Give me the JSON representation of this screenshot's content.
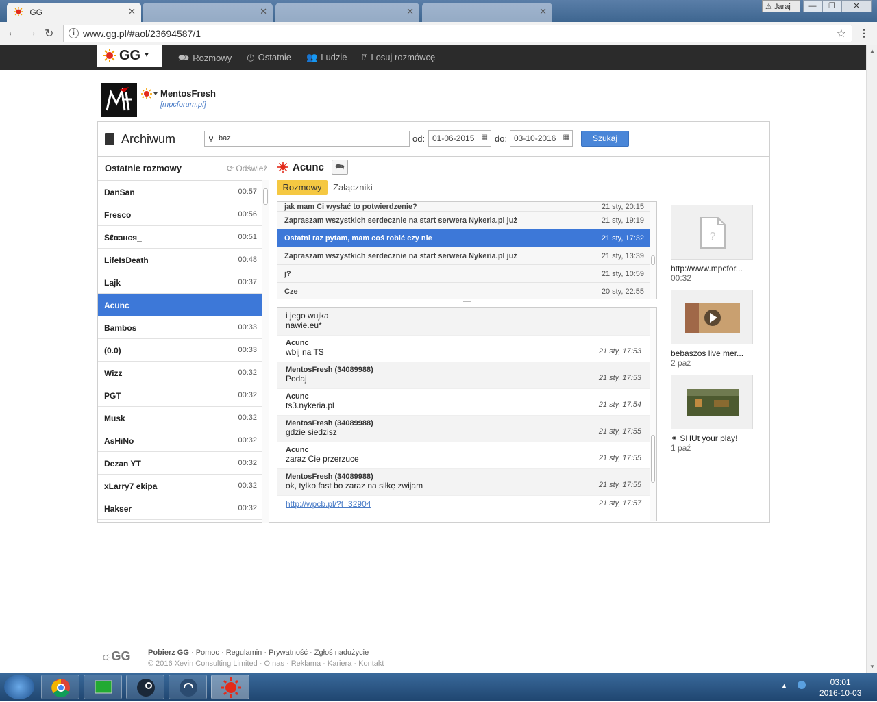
{
  "browser": {
    "active_tab_title": "GG",
    "background_tabs": [
      "",
      "",
      ""
    ],
    "url": "www.gg.pl/#aol/23694587/1",
    "user_badge": "Jaraj"
  },
  "gg_nav": {
    "logo": "GG",
    "links": [
      "Rozmowy",
      "Ostatnie",
      "Ludzie",
      "Losuj rozmówcę"
    ]
  },
  "profile": {
    "name": "MentosFresh",
    "description": "[mpcforum.pl]"
  },
  "archive": {
    "title": "Archiwum",
    "search_value": "baz",
    "from_label": "od:",
    "from_date": "01-06-2015",
    "to_label": "do:",
    "to_date": "03-10-2016",
    "search_button": "Szukaj"
  },
  "recent": {
    "header": "Ostatnie rozmowy",
    "refresh": "Odśwież",
    "items": [
      {
        "name": "DanSan",
        "time": "00:57"
      },
      {
        "name": "Fresco",
        "time": "00:56"
      },
      {
        "name": "Sℓαзнєя_",
        "time": "00:51"
      },
      {
        "name": "LifeIsDeath",
        "time": "00:48"
      },
      {
        "name": "Lajk",
        "time": "00:37"
      },
      {
        "name": "Acunc",
        "time": ""
      },
      {
        "name": "Bambos",
        "time": "00:33"
      },
      {
        "name": "(0.0)",
        "time": "00:33"
      },
      {
        "name": "Wizz",
        "time": "00:32"
      },
      {
        "name": "PGT",
        "time": "00:32"
      },
      {
        "name": "Musk",
        "time": "00:32"
      },
      {
        "name": "AsHiNo",
        "time": "00:32"
      },
      {
        "name": "Dezan YT",
        "time": "00:32"
      },
      {
        "name": "xLarry7 ekipa",
        "time": "00:32"
      },
      {
        "name": "Hakser",
        "time": "00:32"
      }
    ]
  },
  "conversation": {
    "contact": "Acunc",
    "tab_conversations": "Rozmowy",
    "tab_attachments": "Załączniki",
    "threads": [
      {
        "text": "jak mam Ci wysłać to potwierdzenie?",
        "date": "21 sty, 20:15"
      },
      {
        "text": "Zapraszam wszystkich serdecznie na start serwera Nykeria.pl już",
        "date": "21 sty, 19:19"
      },
      {
        "text": "Ostatni raz pytam, mam coś robić czy nie",
        "date": "21 sty, 17:32"
      },
      {
        "text": "Zapraszam wszystkich serdecznie na start serwera Nykeria.pl już",
        "date": "21 sty, 13:39"
      },
      {
        "text": "j?",
        "date": "21 sty, 10:59"
      },
      {
        "text": "Cze",
        "date": "20 sty, 22:55"
      }
    ],
    "messages": [
      {
        "author": "",
        "text": "i jego wujka",
        "text2": "nawie.eu*",
        "time": ""
      },
      {
        "author": "Acunc",
        "text": "wbij na TS",
        "time": "21 sty, 17:53"
      },
      {
        "author": "MentosFresh (34089988)",
        "text": "Podaj",
        "time": "21 sty, 17:53"
      },
      {
        "author": "Acunc",
        "text": "ts3.nykeria.pl",
        "time": "21 sty, 17:54"
      },
      {
        "author": "MentosFresh (34089988)",
        "text": "gdzie siedzisz",
        "time": "21 sty, 17:55"
      },
      {
        "author": "Acunc",
        "text": "zaraz Cie przerzuce",
        "time": "21 sty, 17:55"
      },
      {
        "author": "MentosFresh (34089988)",
        "text": "ok, tylko fast bo zaraz na siłkę zwijam",
        "time": "21 sty, 17:55"
      },
      {
        "author": "",
        "text": "http://wpcb.pl/?t=32904",
        "time": "21 sty, 17:57"
      }
    ]
  },
  "attachments": [
    {
      "caption": "http://www.mpcfor...",
      "sub": "00:32"
    },
    {
      "caption": "bebaszos live mer...",
      "sub": "2 paź"
    },
    {
      "caption": "SHUt your play!",
      "sub": "1 paź"
    }
  ],
  "footer": {
    "logo": "GG",
    "links1": [
      "Pobierz GG",
      "Pomoc",
      "Regulamin",
      "Prywatność",
      "Zgłoś nadużycie"
    ],
    "copyright": "© 2016 Xevin Consulting Limited",
    "links2": [
      "O nas",
      "Reklama",
      "Kariera",
      "Kontakt"
    ]
  },
  "taskbar": {
    "time": "03:01",
    "date": "2016-10-03"
  },
  "colors": {
    "accent_blue": "#3d78d8",
    "tab_yellow": "#f5c842",
    "nav_dark": "#2b2b2b",
    "gg_sun_red": "#e32b1b"
  }
}
